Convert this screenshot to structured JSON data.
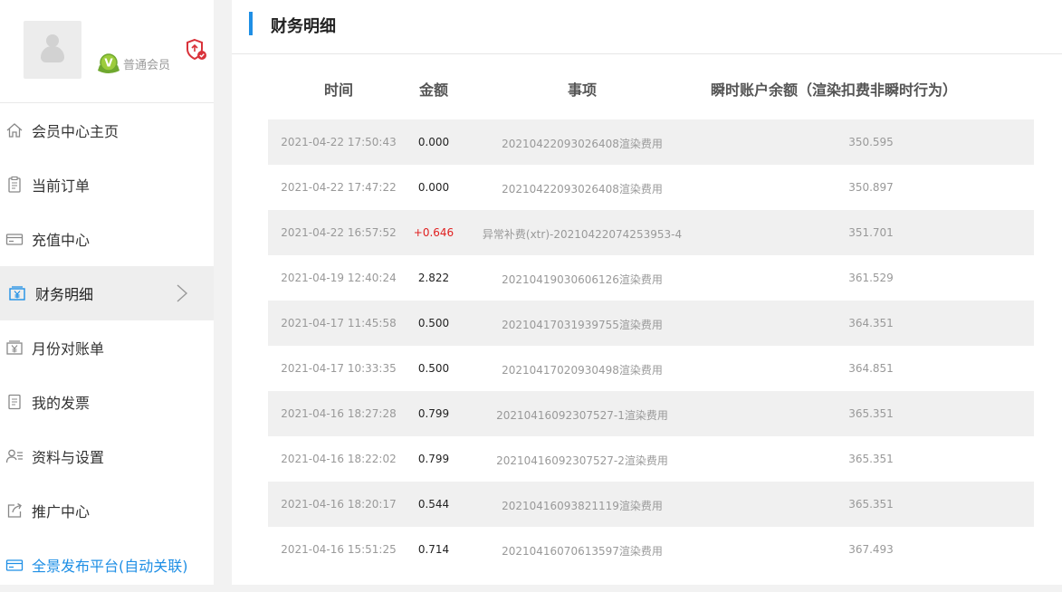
{
  "profile": {
    "member_level": "普通会员"
  },
  "nav": {
    "items": [
      {
        "label": "会员中心主页",
        "icon": "home-icon"
      },
      {
        "label": "当前订单",
        "icon": "clipboard-icon"
      },
      {
        "label": "充值中心",
        "icon": "card-icon"
      },
      {
        "label": "财务明细",
        "icon": "yen-box-icon",
        "active": true
      },
      {
        "label": "月份对账单",
        "icon": "yen-box-icon"
      },
      {
        "label": "我的发票",
        "icon": "invoice-icon"
      },
      {
        "label": "资料与设置",
        "icon": "user-settings-icon"
      },
      {
        "label": "推广中心",
        "icon": "share-icon"
      },
      {
        "label": "全景发布平台(自动关联)",
        "icon": "card-icon"
      }
    ]
  },
  "page": {
    "title": "财务明细"
  },
  "table": {
    "columns": [
      "时间",
      "金额",
      "事项",
      "瞬时账户余额（渲染扣费非瞬时行为）"
    ],
    "rows": [
      {
        "time": "2021-04-22 17:50:43",
        "amount": "0.000",
        "item": "20210422093026408渲染费用",
        "balance": "350.595"
      },
      {
        "time": "2021-04-22 17:47:22",
        "amount": "0.000",
        "item": "20210422093026408渲染费用",
        "balance": "350.897"
      },
      {
        "time": "2021-04-22 16:57:52",
        "amount": "+0.646",
        "item": "异常补费(xtr)-20210422074253953-4",
        "balance": "351.701"
      },
      {
        "time": "2021-04-19 12:40:24",
        "amount": "2.822",
        "item": "20210419030606126渲染费用",
        "balance": "361.529"
      },
      {
        "time": "2021-04-17 11:45:58",
        "amount": "0.500",
        "item": "20210417031939755渲染费用",
        "balance": "364.351"
      },
      {
        "time": "2021-04-17 10:33:35",
        "amount": "0.500",
        "item": "20210417020930498渲染费用",
        "balance": "364.851"
      },
      {
        "time": "2021-04-16 18:27:28",
        "amount": "0.799",
        "item": "20210416092307527-1渲染费用",
        "balance": "365.351"
      },
      {
        "time": "2021-04-16 18:22:02",
        "amount": "0.799",
        "item": "20210416092307527-2渲染费用",
        "balance": "365.351"
      },
      {
        "time": "2021-04-16 18:20:17",
        "amount": "0.544",
        "item": "20210416093821119渲染费用",
        "balance": "365.351"
      },
      {
        "time": "2021-04-16 15:51:25",
        "amount": "0.714",
        "item": "20210416070613597渲染费用",
        "balance": "367.493"
      }
    ]
  },
  "colors": {
    "accent": "#1f8fe5",
    "positive_amount": "#e02020",
    "row_stripe": "#f0f0f0"
  }
}
